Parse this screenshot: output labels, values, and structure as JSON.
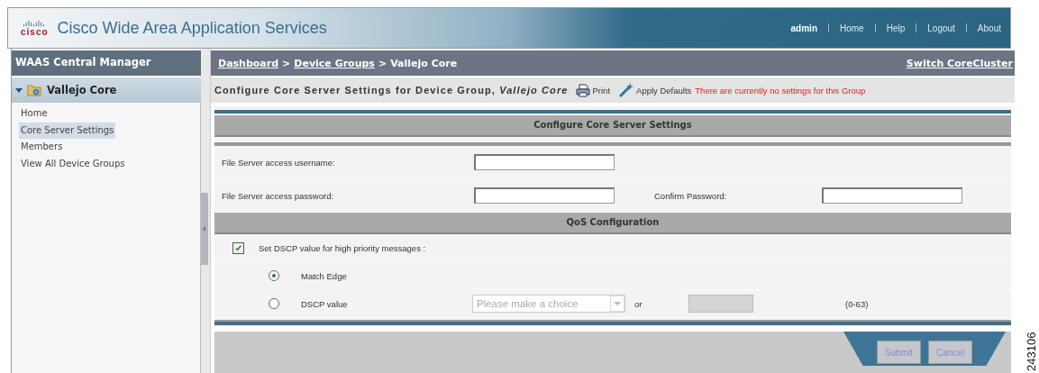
{
  "header": {
    "logo_text": "cisco",
    "title": "Cisco Wide Area Application Services",
    "user": "admin",
    "links": [
      "Home",
      "Help",
      "Logout",
      "About"
    ]
  },
  "sidebar": {
    "title": "WAAS Central Manager",
    "group": {
      "label": "Vallejo Core",
      "expanded": true
    },
    "items": [
      {
        "label": "Home",
        "selected": false
      },
      {
        "label": "Core Server Settings",
        "selected": true
      },
      {
        "label": "Members",
        "selected": false
      },
      {
        "label": "View All Device Groups",
        "selected": false
      }
    ]
  },
  "breadcrumb": {
    "separator": ">",
    "items": [
      {
        "label": "Dashboard",
        "link": true
      },
      {
        "label": "Device Groups",
        "link": true
      },
      {
        "label": "Vallejo Core",
        "link": false
      }
    ]
  },
  "switch_link": "Switch CoreCluster",
  "page_title": "Configure Core Server Settings for Device Group, *Vallejo Core*",
  "toolbar": [
    {
      "kind": "print",
      "label": "Print"
    },
    {
      "kind": "wand",
      "label": "Apply Defaults"
    }
  ],
  "notice": "There are currently no settings for this Group",
  "server_section": {
    "title": "Configure Core Server Settings",
    "username_label": "File Server access username:",
    "password_label": "File Server access password:",
    "confirm_label": "Confirm Password:"
  },
  "qos_section": {
    "title": "QoS Configuration",
    "dscp_checkbox": {
      "label": "Set  DSCP value for high priority messages :",
      "checked": true
    },
    "options": [
      {
        "label": "Match Edge",
        "selected": true
      },
      {
        "label": "DSCP value",
        "selected": false
      }
    ],
    "dropdown": {
      "placeholder": "Please make a choice",
      "disabled": true
    },
    "or_text": "or",
    "value_field": {
      "disabled": true
    },
    "range": "(0-63)"
  },
  "buttons": [
    "Submit",
    "Cancel"
  ],
  "figure_id": "243106"
}
